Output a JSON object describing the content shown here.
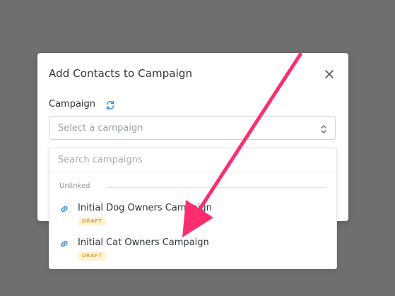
{
  "modal": {
    "title": "Add Contacts to Campaign",
    "close_icon": "close-icon"
  },
  "campaign_field": {
    "label": "Campaign",
    "refresh_icon": "refresh-icon",
    "placeholder": "Select a campaign",
    "chevron_icon": "chevron-updown-icon"
  },
  "dropdown": {
    "search_placeholder": "Search campaigns",
    "group_label": "Unlinked",
    "options": [
      {
        "name": "Initial Dog Owners Campaign",
        "badge": "DRAFT",
        "icon": "link-icon"
      },
      {
        "name": "Initial Cat Owners Campaign",
        "badge": "DRAFT",
        "icon": "link-icon"
      }
    ]
  },
  "colors": {
    "overlay": "#6f6f6f",
    "accent_blue": "#2b8fd6",
    "arrow_pink": "#ff2d6f",
    "badge_bg": "#fff3d6",
    "badge_text": "#e4a82b"
  }
}
